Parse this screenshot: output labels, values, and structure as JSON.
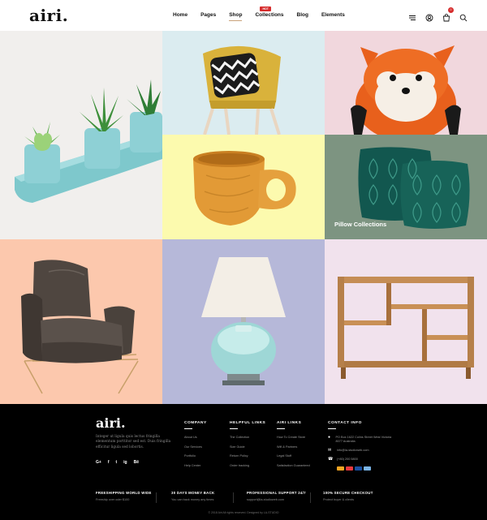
{
  "header": {
    "logo": "airi.",
    "nav": [
      {
        "label": "Home"
      },
      {
        "label": "Pages"
      },
      {
        "label": "Shop"
      },
      {
        "label": "Collections",
        "badge": "HOT"
      },
      {
        "label": "Blog"
      },
      {
        "label": "Elements"
      }
    ],
    "active_nav": "Shop",
    "icons": [
      "menu-icon",
      "user-icon",
      "cart-icon",
      "search-icon"
    ],
    "cart_count": "0"
  },
  "tiles": [
    {
      "name": "succulents",
      "bg": "#f1efed"
    },
    {
      "name": "chair-pillow",
      "bg": "#dbecf0"
    },
    {
      "name": "fox-plush",
      "bg": "#f1d7dd"
    },
    {
      "name": "wooden-cup",
      "bg": "#fcfaae"
    },
    {
      "name": "pillows",
      "bg": "#7d9481",
      "label": "Pillow Collections"
    },
    {
      "name": "leather-armchair",
      "bg": "#fcc8ad"
    },
    {
      "name": "table-lamp",
      "bg": "#b6b8d9"
    },
    {
      "name": "wooden-shelf",
      "bg": "#f1e2ed"
    }
  ],
  "footer": {
    "logo": "airi.",
    "description": "Integer ut ligula quis lectus fringilla elementum porttitor sed est. Duis fringilla efficitur ligula sed lobortis.",
    "social": [
      "G+",
      "f",
      "t",
      "ig",
      "Bē"
    ],
    "columns": [
      {
        "title": "COMPANY",
        "links": [
          "About Us",
          "Our Services",
          "Portfolio",
          "Help Center"
        ]
      },
      {
        "title": "HELPFUL LINKS",
        "links": [
          "The Collection",
          "Size Guide",
          "Return Policy",
          "Order tracking"
        ]
      },
      {
        "title": "AIRI LINKS",
        "links": [
          "How To Create Store",
          "Wifi & Partners",
          "Legal Stuff",
          "Satisfaction Guaranteed"
        ]
      }
    ],
    "contact": {
      "title": "CONTACT INFO",
      "address": "PO Box 1622 Colins Street West Victoria 8077 Australia",
      "email": "info@la-studioweb.com",
      "phone": "(+80) 200 5800"
    },
    "payment_colors": [
      "#f5a623",
      "#e8383d",
      "#1a4fa0",
      "#7ab4e6"
    ],
    "features": [
      {
        "title": "FREESHIPPING WORLD WIDE",
        "text": "Freeship over oder $100"
      },
      {
        "title": "30 DAYS MONEY BACK",
        "text": "You can back money any times"
      },
      {
        "title": "PROFESSIONAL SUPPORT 24/7",
        "text": "support@la-studioweb.com"
      },
      {
        "title": "100% SECURE CHECKOUT",
        "text": "Protect buyer & clients"
      }
    ],
    "copyright": "© 2018 Airi All rights reserved. Designed by LA-STUDIO"
  }
}
